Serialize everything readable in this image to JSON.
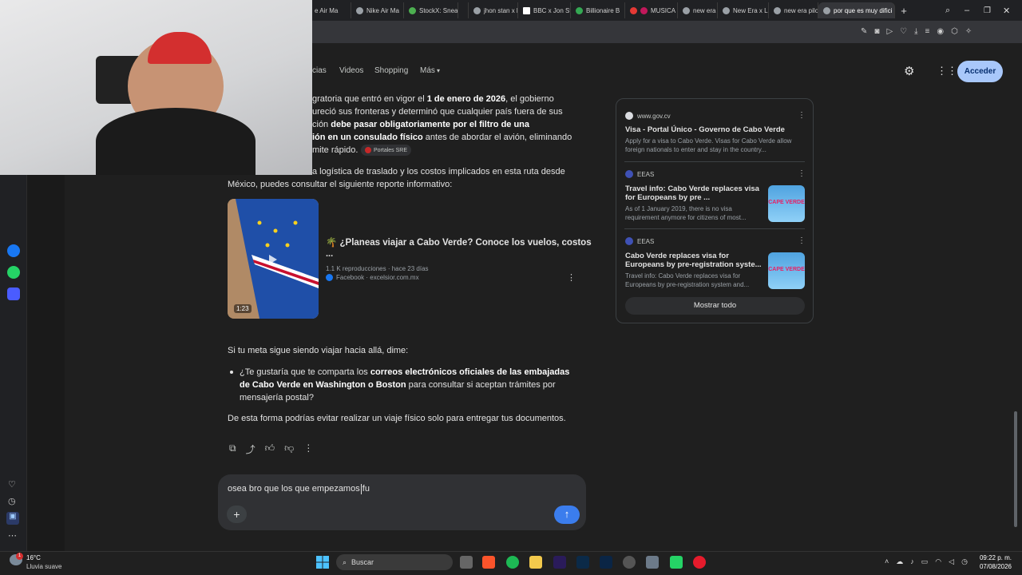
{
  "tabs": [
    {
      "label": "e Air Ma"
    },
    {
      "label": "Nike Air Ma"
    },
    {
      "label": "StockX: Snea"
    },
    {
      "label": "jhon stan x l"
    },
    {
      "label": "BBC x Jon St"
    },
    {
      "label": "Billionaire B"
    },
    {
      "label": "MUSICA"
    },
    {
      "label": "new era x n"
    },
    {
      "label": "New Era x Li"
    },
    {
      "label": "new era pilo"
    },
    {
      "label": "por que es muy difici"
    }
  ],
  "google": {
    "nav": [
      "cias",
      "Videos",
      "Shopping",
      "Más"
    ],
    "signin": "Acceder"
  },
  "answer": {
    "p1_a": "gratoria que entró en vigor el ",
    "p1_b": "1 de enero de 2026",
    "p1_c": ", el gobierno",
    "p1_line2": "ureció sus fronteras y determinó que cualquier país fuera de sus",
    "p1_line3a": "ción ",
    "p1_line3b": "debe pasar obligatoriamente por el filtro de una",
    "p1_line4a": "ión en un consulado físico",
    "p1_line4b": " antes de abordar el avión, eliminando",
    "p1_line5": "mite rápido.",
    "chip": "Portales SRE",
    "p2_line1": "a logística de traslado y los costos implicados en esta ruta desde",
    "p2_line2": "México, puedes consultar el siguiente reporte informativo:",
    "video_title": "🌴 ¿Planeas viajar a Cabo Verde? Conoce los vuelos, costos",
    "video_title2": "...",
    "video_meta": "1.1 K reproducciones · hace 23 días",
    "video_source": "Facebook · excelsior.com.mx",
    "video_duration": "1:23",
    "p3": "Si tu meta sigue siendo viajar hacia allá, dime:",
    "bullet_a": "¿Te gustaría que te comparta los ",
    "bullet_b": "correos electrónicos oficiales de las embajadas",
    "bullet_line2b": "de Cabo Verde en Washington o Boston",
    "bullet_line2c": " para consultar si aceptan trámites por",
    "bullet_line3": "mensajería postal?",
    "p4": "De esta forma podrías evitar realizar un viaje físico solo para entregar tus documentos."
  },
  "sources": [
    {
      "site": "www.gov.cv",
      "title": "Visa - Portal Único - Governo de Cabo Verde",
      "snippet1": "Apply for a visa to Cabo Verde. Visas for Cabo Verde allow",
      "snippet2": "foreign nationals to enter and stay in the country..."
    },
    {
      "site": "EEAS",
      "title": "Travel info: Cabo Verde replaces visa",
      "title2": "for Europeans by pre ...",
      "snippet1": "As of 1 January 2019, there is no visa",
      "snippet2": "requirement anymore for citizens of most...",
      "thumb": "CAPE VERDE"
    },
    {
      "site": "EEAS",
      "title": "Cabo Verde replaces visa for",
      "title2": "Europeans by pre-registration syste...",
      "snippet1": "Travel info: Cabo Verde replaces visa for",
      "snippet2": "Europeans by pre-registration system and...",
      "thumb": "CAPE VERDE"
    }
  ],
  "show_all": "Mostrar todo",
  "prompt": {
    "value": "osea bro que los que empezamos fu"
  },
  "taskbar": {
    "weather_temp": "16°C",
    "weather_desc": "Lluvia suave",
    "search": "Buscar",
    "time": "09:22 p. m.",
    "date": "07/08/2026",
    "weather_badge": "1"
  },
  "colors": {
    "accent": "#8ab4f8",
    "send": "#3b7ded",
    "signin_bg": "#a8c7fa"
  }
}
